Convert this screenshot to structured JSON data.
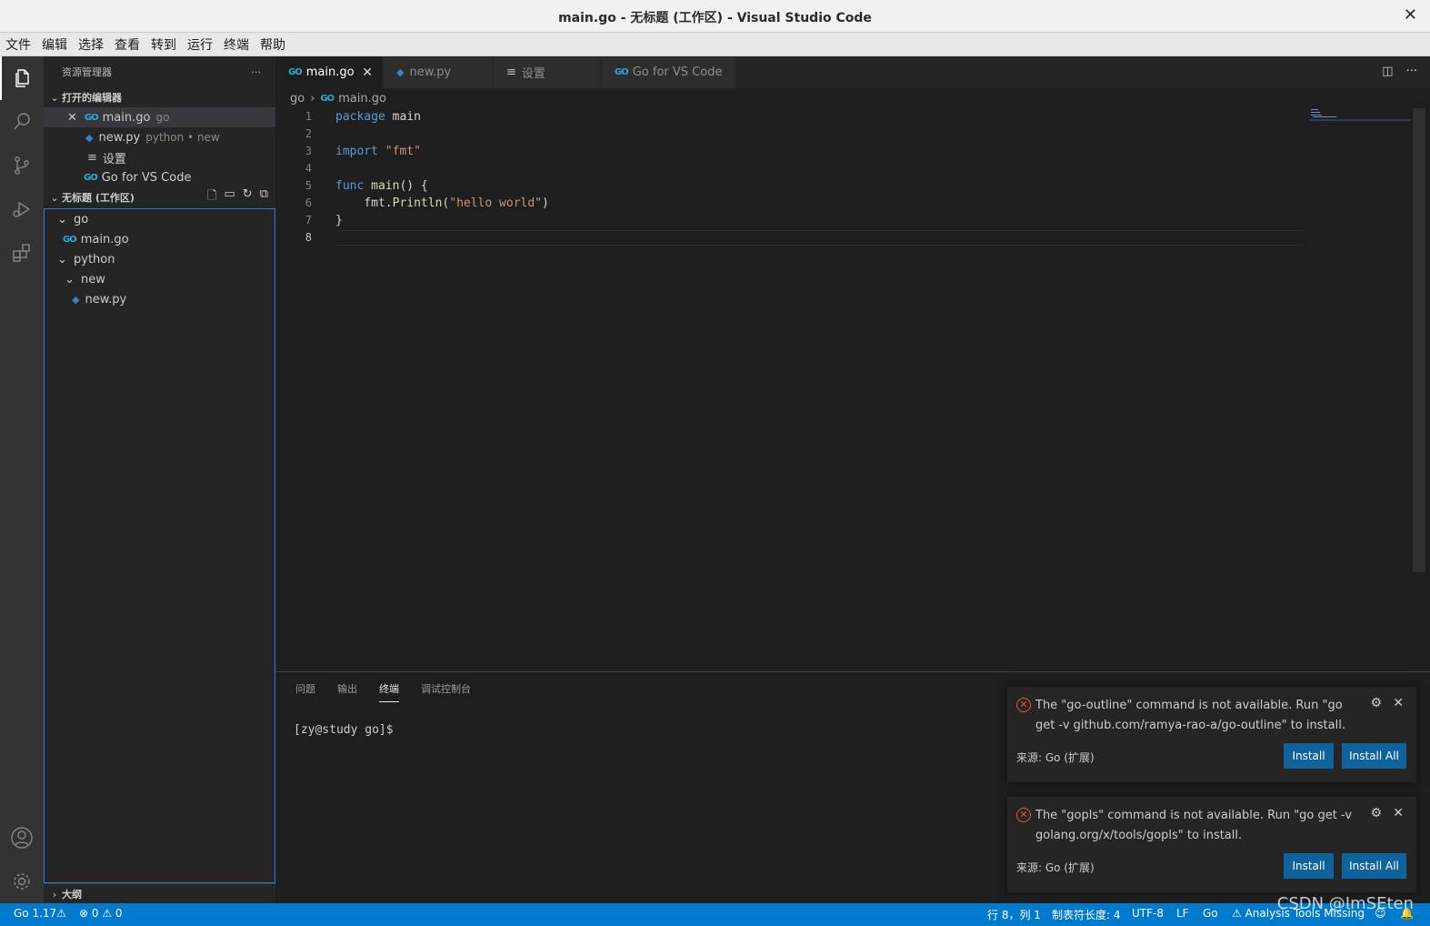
{
  "window": {
    "title": "main.go - 无标题 (工作区) - Visual Studio Code",
    "close_glyph": "✕"
  },
  "menu": [
    "文件",
    "编辑",
    "选择",
    "查看",
    "转到",
    "运行",
    "终端",
    "帮助"
  ],
  "sidebar": {
    "title": "资源管理器",
    "more": "···",
    "open_editors": {
      "header": "打开的编辑器",
      "items": [
        {
          "name": "main.go",
          "desc": "go"
        },
        {
          "name": "new.py",
          "desc": "python • new"
        },
        {
          "name": "设置",
          "desc": ""
        },
        {
          "name": "Go for VS Code",
          "desc": ""
        }
      ]
    },
    "workspace": {
      "header": "无标题 (工作区)",
      "tree": [
        {
          "label": "go"
        },
        {
          "label": "main.go"
        },
        {
          "label": "python"
        },
        {
          "label": "new"
        },
        {
          "label": "new.py"
        }
      ]
    },
    "outline": "大纲"
  },
  "tabs": [
    "main.go",
    "new.py",
    "设置",
    "Go for VS Code"
  ],
  "breadcrumb": {
    "folder": "go",
    "file": "main.go"
  },
  "editor": {
    "line_numbers": [
      "1",
      "2",
      "3",
      "4",
      "5",
      "6",
      "7",
      "8"
    ],
    "lines": [
      "package main",
      "",
      "import \"fmt\"",
      "",
      "func main() {",
      "    fmt.Println(\"hello world\")",
      "}",
      ""
    ]
  },
  "panel": {
    "tabs": [
      "问题",
      "输出",
      "终端",
      "调试控制台"
    ],
    "active_tab": "终端",
    "terminal_prompt": "[zy@study go]$"
  },
  "notifications": [
    {
      "message": "The \"go-outline\" command is not available. Run \"go get -v github.com/ramya-rao-a/go-outline\" to install.",
      "source": "来源: Go (扩展)",
      "install": "Install",
      "install_all": "Install All"
    },
    {
      "message": "The \"gopls\" command is not available. Run \"go get -v golang.org/x/tools/gopls\" to install.",
      "source": "来源: Go (扩展)",
      "install": "Install",
      "install_all": "Install All"
    }
  ],
  "statusbar": {
    "go_version": "Go 1.17⚠",
    "problems": "⊗ 0 ⚠ 0",
    "position": "行 8，列 1",
    "tab_size": "制表符长度: 4",
    "encoding": "UTF-8",
    "eol": "LF",
    "language": "Go",
    "analysis": "⚠ Analysis Tools Missing"
  },
  "watermark": "CSDN @ImSEten",
  "colors": {
    "accent": "#007acc",
    "error": "#f14c4c",
    "button": "#0e639c"
  }
}
